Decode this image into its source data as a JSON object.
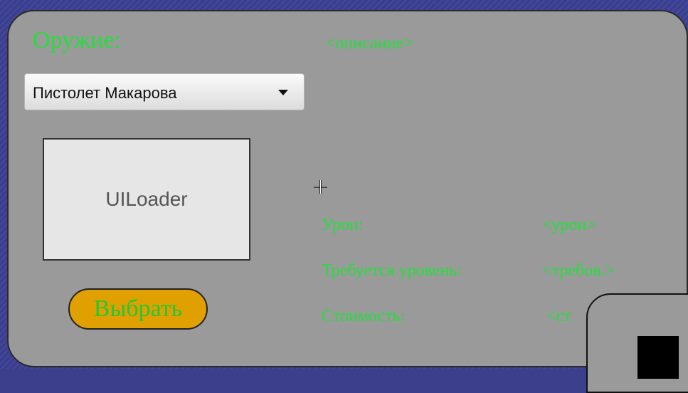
{
  "weapon": {
    "label": "Оружие:",
    "selected": "Пистолет Макарова"
  },
  "description_placeholder": "<описание>",
  "loader": {
    "label": "UILoader"
  },
  "select_button": {
    "label": "Выбрать"
  },
  "stats": {
    "damage": {
      "label": "Урон:",
      "value": "<урон>"
    },
    "requirement": {
      "label": "Требуется уровень:",
      "value": "<требов.>"
    },
    "cost": {
      "label": "Стоимость:",
      "value": "<ст"
    }
  },
  "colors": {
    "label_green": "#22e03a",
    "panel": "#9a9a9a",
    "button": "#e0a000",
    "background": "#3b3f8c"
  },
  "icons": {
    "cursor": "crosshair-cursor-icon",
    "combo": "chevron-down-icon"
  }
}
